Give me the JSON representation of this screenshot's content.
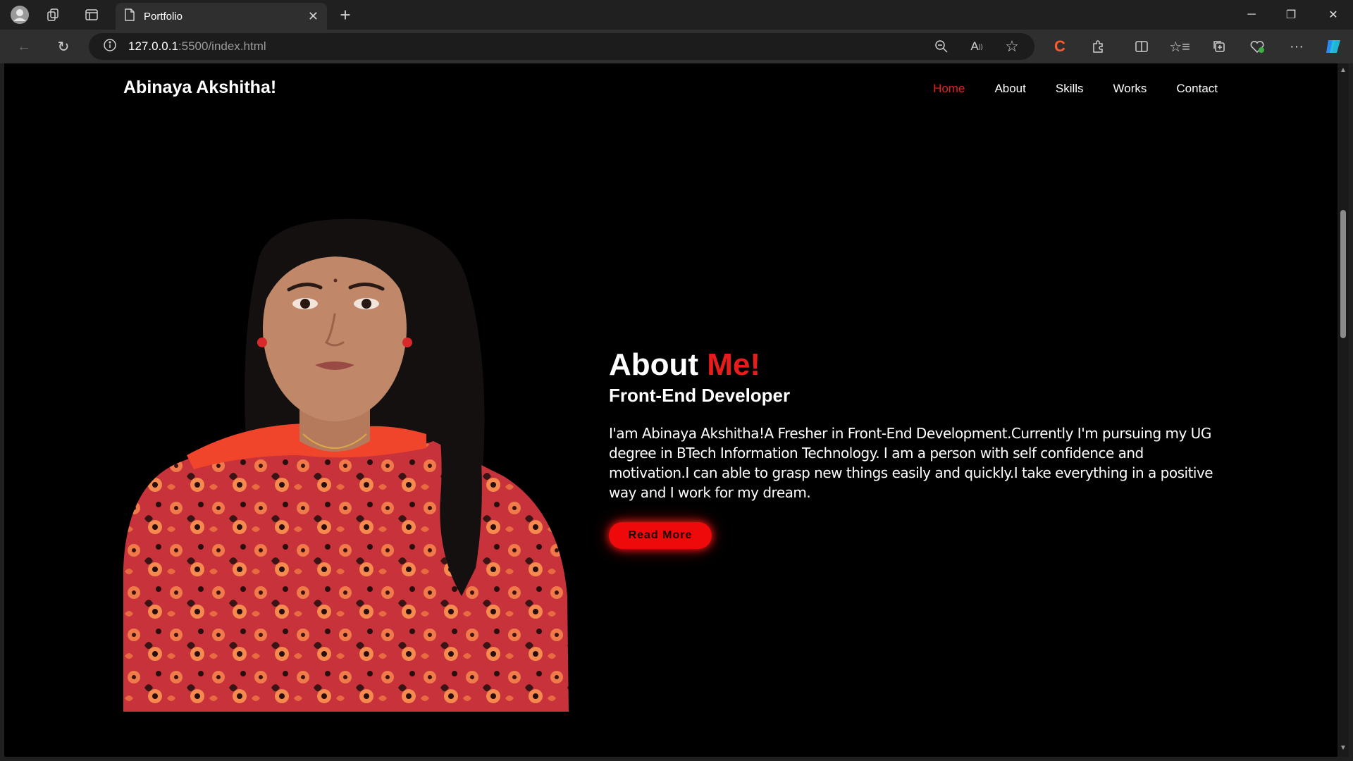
{
  "browser": {
    "tab_title": "Portfolio",
    "url_host": "127.0.0.1",
    "url_path": ":5500/index.html"
  },
  "site": {
    "logo": "Abinaya Akshitha!",
    "nav": [
      {
        "label": "Home",
        "active": true
      },
      {
        "label": "About",
        "active": false
      },
      {
        "label": "Skills",
        "active": false
      },
      {
        "label": "Works",
        "active": false
      },
      {
        "label": "Contact",
        "active": false
      }
    ]
  },
  "about": {
    "heading_main": "About",
    "heading_accent": "Me!",
    "subheading": "Front-End Developer",
    "paragraph": "I'am Abinaya Akshitha!A Fresher in Front-End Development.Currently I'm pursuing my UG degree in BTech Information Technology. I am a person with self confidence and motivation.I can able to grasp new things easily and quickly.I take everything in a positive way and I work for my dream.",
    "button_label": "Read More"
  },
  "colors": {
    "accent": "#e91c1c",
    "background": "#000000",
    "text": "#ffffff"
  }
}
